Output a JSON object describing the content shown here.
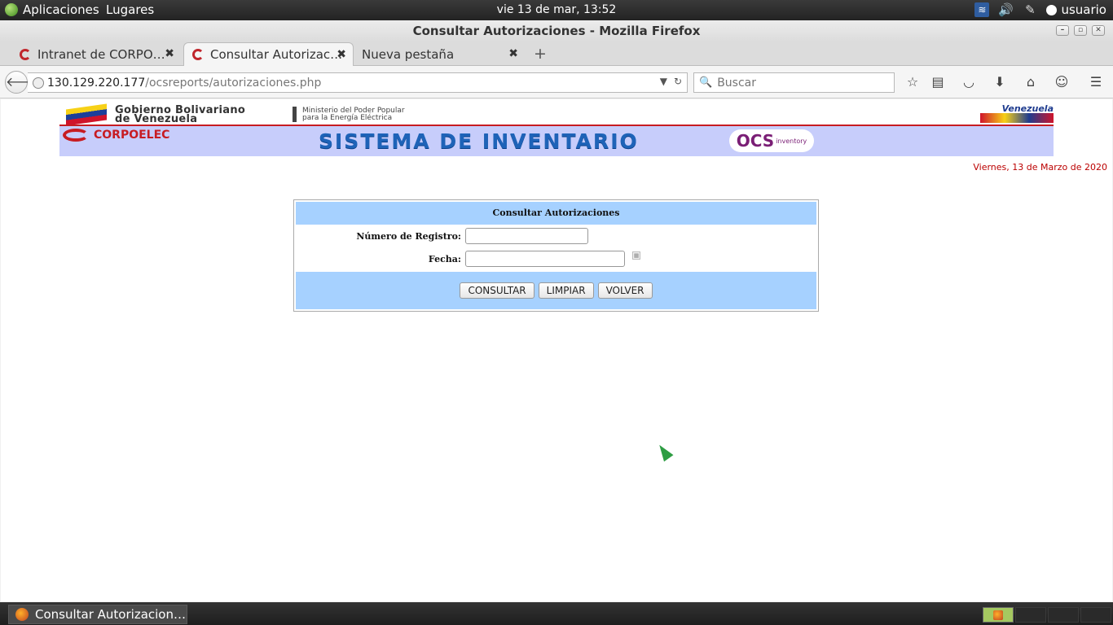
{
  "panel": {
    "applications": "Aplicaciones",
    "places": "Lugares",
    "clock": "vie 13 de mar, 13:52",
    "user": "usuario"
  },
  "window": {
    "title": "Consultar Autorizaciones - Mozilla Firefox"
  },
  "tabs": [
    {
      "label": "Intranet de CORPO…"
    },
    {
      "label": "Consultar Autorizac…"
    },
    {
      "label": "Nueva pestaña"
    }
  ],
  "navbar": {
    "url_host": "130.129.220.177",
    "url_path": "/ocsreports/autorizaciones.php",
    "search_placeholder": "Buscar"
  },
  "banner": {
    "gov_line1": "Gobierno Bolivariano",
    "gov_line2": "de Venezuela",
    "ministry_line1": "Ministerio del Poder Popular",
    "ministry_line2": "para la Energía Eléctrica",
    "venezuela": "Venezuela",
    "company": "CORPOELEC",
    "system_title": "SISTEMA DE INVENTARIO",
    "ocs_logo": "OCS",
    "ocs_sub": "inventory"
  },
  "page": {
    "date": "Viernes, 13 de Marzo de 2020"
  },
  "form": {
    "title": "Consultar Autorizaciones",
    "registro_label": "Número de Registro:",
    "registro_value": "",
    "fecha_label": "Fecha:",
    "fecha_value": "",
    "consultar": "CONSULTAR",
    "limpiar": "LIMPIAR",
    "volver": "VOLVER"
  },
  "taskbar": {
    "item": "Consultar Autorizacion…"
  }
}
